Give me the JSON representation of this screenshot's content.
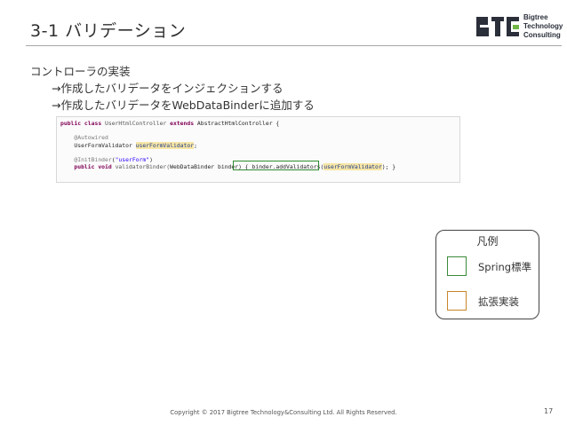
{
  "slide": {
    "title": "3-1 バリデーション",
    "logo_text": [
      "Bigtree",
      "Technology",
      "Consulting"
    ],
    "bullets": [
      "コントローラの実装",
      "→作成したバリデータをインジェクションする",
      "→作成したバリデータをWebDataBinderに追加する"
    ],
    "code_lines": [
      {
        "kw1": "public class",
        "t1": " UserHtmlController ",
        "kw2": "extends",
        "t2": " AbstractHtmlController {"
      },
      {
        "ann": "@Autowired"
      },
      {
        "t1": "UserFormValidator ",
        "fld": "userFormValidator",
        "t2": ";"
      },
      {
        "ann": "@InitBinder",
        "t1": "(",
        "str": "\"userForm\"",
        "t2": ")"
      },
      {
        "kw1": "public void",
        "t1": " validatorBinder(",
        "box": "WebDataBinder binder)",
        "t2": " { binder.addValidators(",
        "fld": "userFormValidator",
        "t3": "); }"
      }
    ],
    "legend": {
      "title": "凡例",
      "items": [
        "Spring標準",
        "拡張実装"
      ],
      "colors": [
        "#3a8a3a",
        "#c8862a"
      ]
    },
    "footer": "Copyright © 2017 Bigtree Technology&Consulting Ltd. All Rights Reserved.",
    "page_number": "17"
  }
}
